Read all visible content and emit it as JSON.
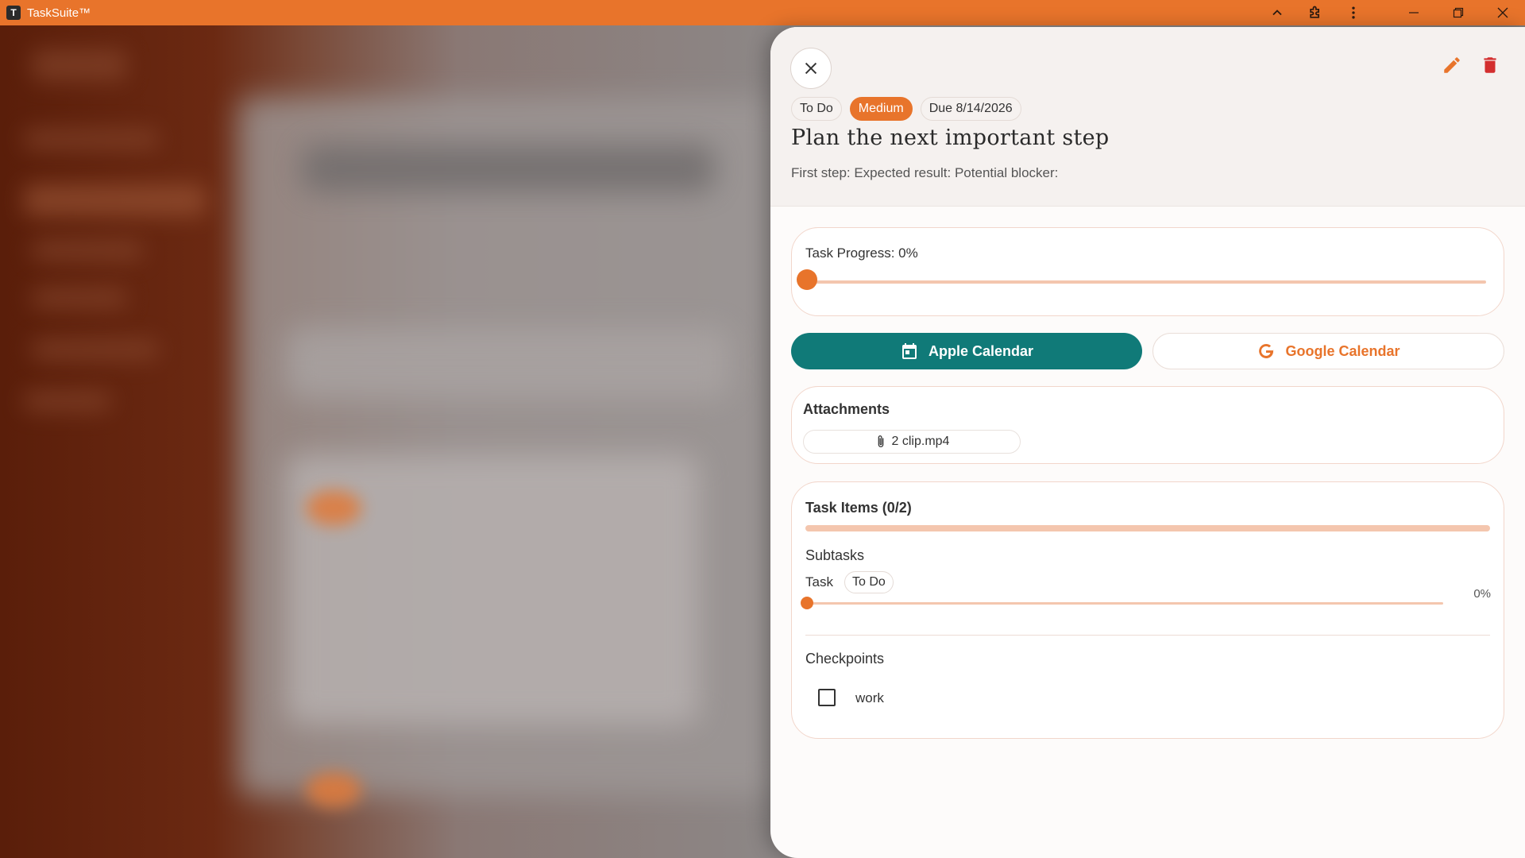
{
  "window": {
    "app_title": "TaskSuite™",
    "logo_letter": "T"
  },
  "task": {
    "status": "To Do",
    "priority": "Medium",
    "due": "Due 8/14/2026",
    "title": "Plan the next important step",
    "description": "First step: Expected result: Potential blocker:",
    "progress_label": "Task Progress: 0%",
    "progress": 0
  },
  "calendar": {
    "apple_label": "Apple Calendar",
    "google_label": "Google Calendar"
  },
  "attachments": {
    "label": "Attachments",
    "files": [
      "2 clip.mp4"
    ]
  },
  "items": {
    "label": "Task Items (0/2)",
    "subtasks_label": "Subtasks",
    "subtask": {
      "name": "Task",
      "status": "To Do",
      "percent": "0%"
    },
    "checkpoints_label": "Checkpoints",
    "checkpoint": {
      "label": "work",
      "checked": false
    }
  },
  "colors": {
    "accent": "#e8742b",
    "teal": "#107a78",
    "danger": "#d32f2f"
  }
}
